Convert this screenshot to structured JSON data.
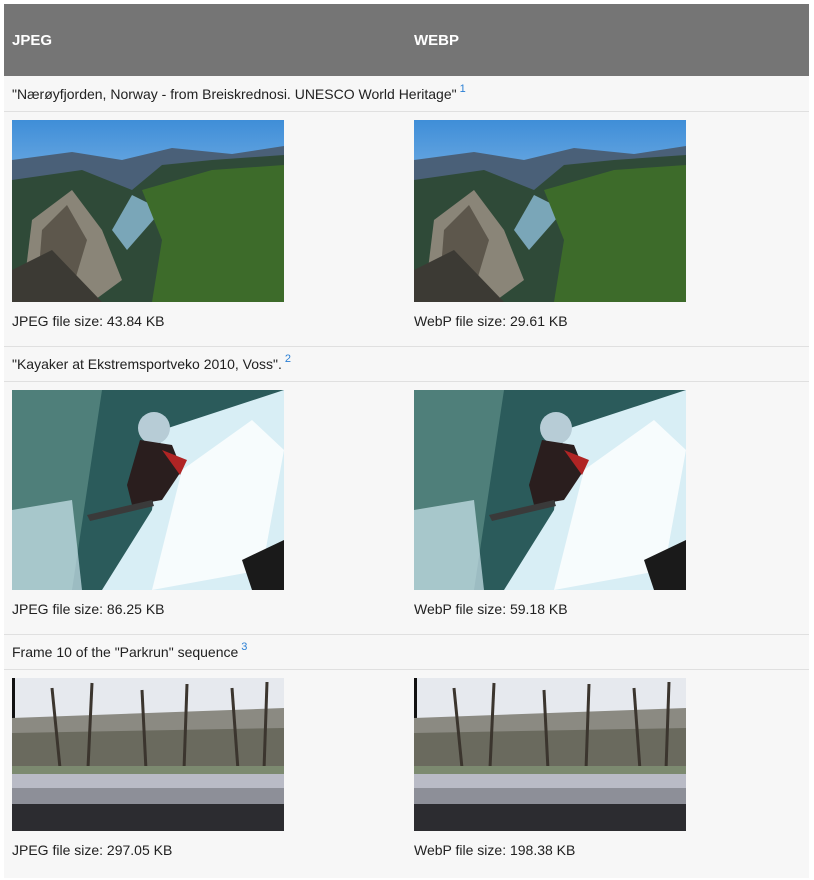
{
  "header": {
    "col1": "JPEG",
    "col2": "WEBP"
  },
  "rows": [
    {
      "caption": "\"Nærøyfjorden, Norway - from Breiskrednosi. UNESCO World Heritage\"",
      "ref": "1",
      "jpeg_size": "JPEG file size: 43.84 KB",
      "webp_size": "WebP file size: 29.61 KB",
      "image": "fjord-landscape"
    },
    {
      "caption": "\"Kayaker at Ekstremsportveko 2010, Voss\".",
      "ref": "2",
      "jpeg_size": "JPEG file size: 86.25 KB",
      "webp_size": "WebP file size: 59.18 KB",
      "image": "kayaker-waterfall"
    },
    {
      "caption": "Frame 10 of the \"Parkrun\" sequence",
      "ref": "3",
      "jpeg_size": "JPEG file size: 297.05 KB",
      "webp_size": "WebP file size: 198.38 KB",
      "image": "park-trees"
    }
  ]
}
